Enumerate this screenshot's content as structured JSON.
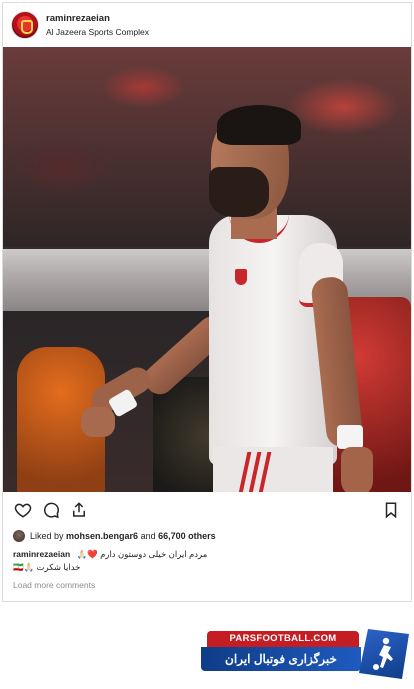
{
  "post": {
    "username": "raminrezaeian",
    "location": "Al Jazeera Sports Complex"
  },
  "actions": {
    "like_icon": "heart-outline-icon",
    "comment_icon": "speech-bubble-icon",
    "share_icon": "share-arrow-icon",
    "save_icon": "bookmark-icon"
  },
  "likes": {
    "prefix": "Liked by",
    "first_liker": "mohsen.bengar6",
    "and_text": "and",
    "others": "66,700 others"
  },
  "caption": {
    "username": "raminrezaeian",
    "line1": "مردم ایران خیلی دوستون دارم ❤️🙏🏻",
    "line2": "خدایا شکرت 🙏🏻🇮🇷"
  },
  "comments": {
    "load_more": "Load more comments"
  },
  "watermark": {
    "site": "PARSFOOTBALL.COM",
    "tagline": "خبرگزاری فوتبال ایران"
  },
  "colors": {
    "text": "#262626",
    "muted": "#8e8e8e",
    "border": "#dbdbdb",
    "logo_red": "#c41e24",
    "logo_blue": "#0f3c87"
  }
}
